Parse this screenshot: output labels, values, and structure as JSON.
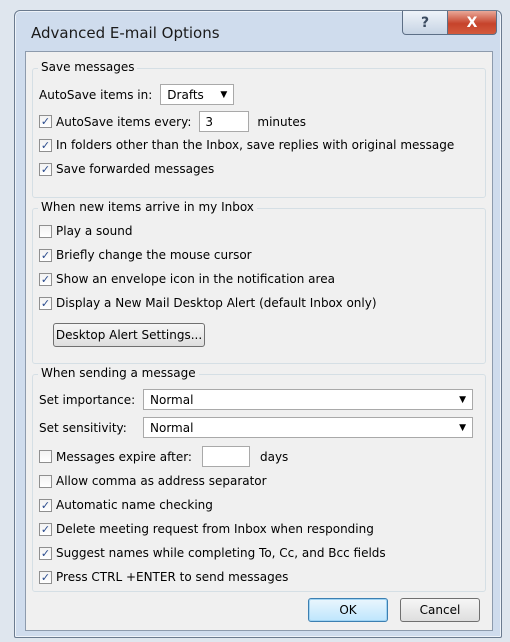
{
  "window": {
    "title": "Advanced E-mail Options",
    "help_label": "?",
    "close_label": "X"
  },
  "save_messages": {
    "legend": "Save messages",
    "autosave_in_label": "AutoSave items in:",
    "autosave_in_value": "Drafts",
    "autosave_every_label": "AutoSave items every:",
    "autosave_every_checked": true,
    "autosave_every_value": "3",
    "minutes_label": "minutes",
    "save_replies_label": "In folders other than the Inbox, save replies with original message",
    "save_replies_checked": true,
    "save_forwarded_label": "Save forwarded messages",
    "save_forwarded_checked": true
  },
  "new_items": {
    "legend": "When new items arrive in my Inbox",
    "options": [
      {
        "label": "Play a sound",
        "checked": false
      },
      {
        "label": "Briefly change the mouse cursor",
        "checked": true
      },
      {
        "label": "Show an envelope icon in the notification area",
        "checked": true
      },
      {
        "label": "Display a New Mail Desktop Alert (default Inbox only)",
        "checked": true
      }
    ],
    "alert_settings_button": "Desktop Alert Settings..."
  },
  "sending": {
    "legend": "When sending a message",
    "importance_label": "Set importance:",
    "importance_value": "Normal",
    "sensitivity_label": "Set sensitivity:",
    "sensitivity_value": "Normal",
    "expire_label": "Messages expire after:",
    "expire_checked": false,
    "expire_value": "",
    "days_label": "days",
    "options": [
      {
        "label": "Allow comma as address separator",
        "checked": false
      },
      {
        "label": "Automatic name checking",
        "checked": true
      },
      {
        "label": "Delete meeting request from Inbox when responding",
        "checked": true
      },
      {
        "label": "Suggest names while completing To, Cc, and Bcc fields",
        "checked": true
      },
      {
        "label": "Press CTRL +ENTER to send messages",
        "checked": true
      }
    ]
  },
  "footer": {
    "ok_label": "OK",
    "cancel_label": "Cancel"
  },
  "checkmark_glyph": "✓",
  "dropdown_glyph": "▼"
}
